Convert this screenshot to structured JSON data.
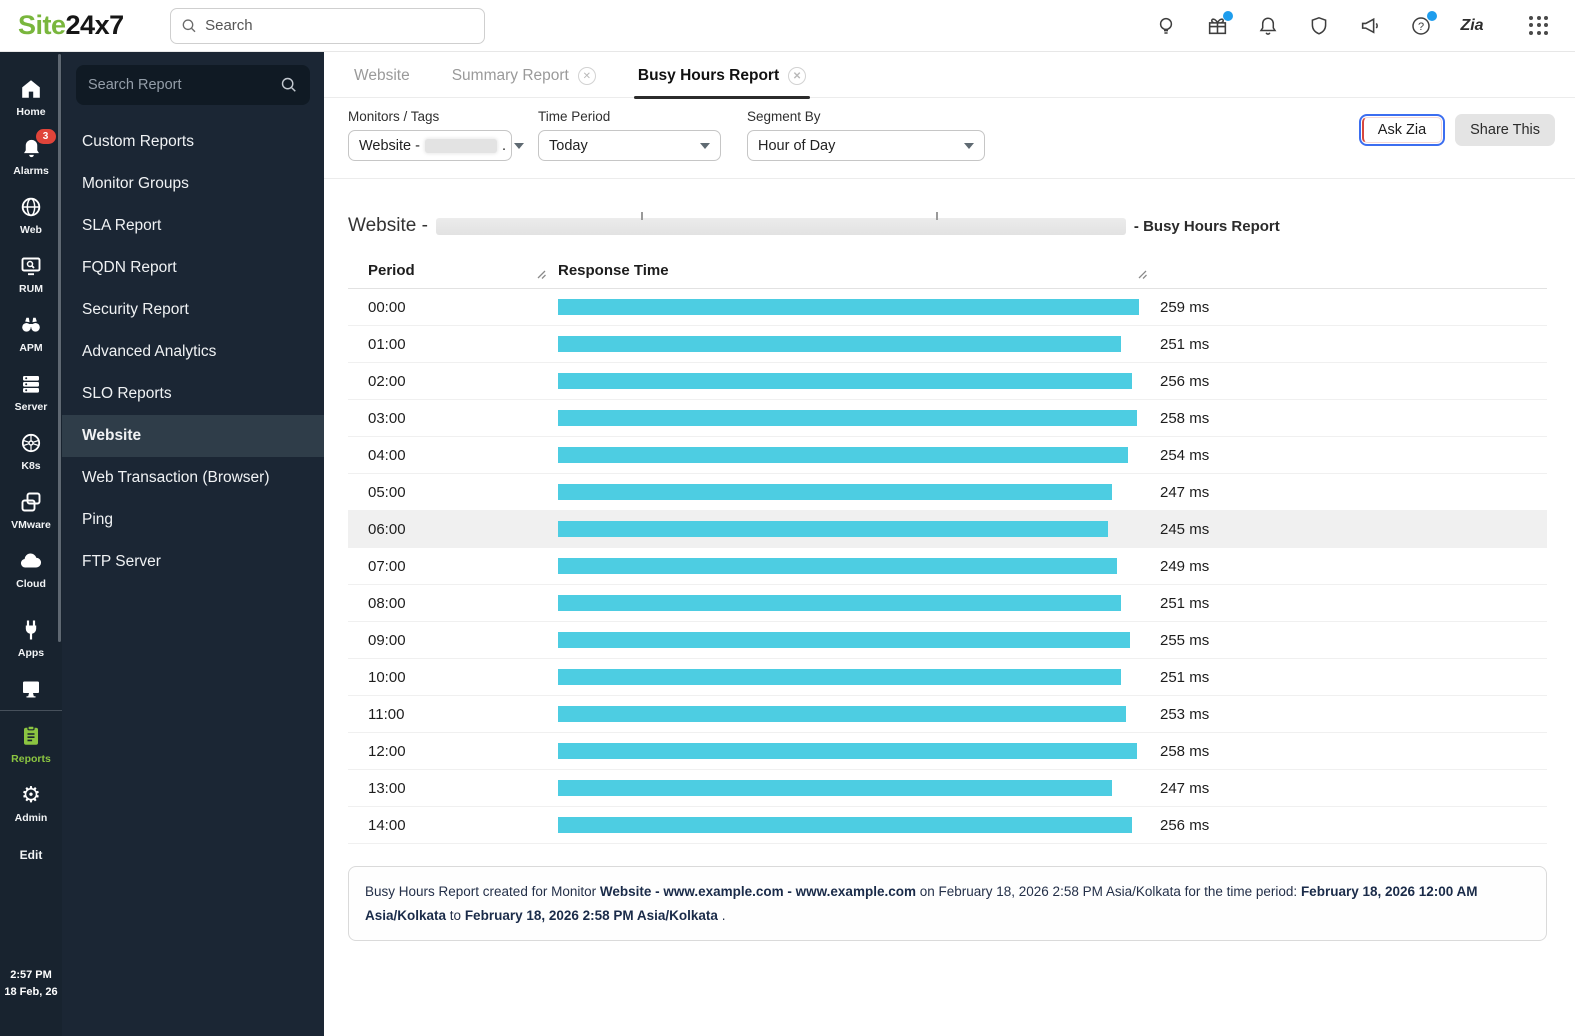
{
  "topbar": {
    "logo_green": "Site",
    "logo_dark": "24x7",
    "search_placeholder": "Search",
    "icons": [
      "bulb-icon",
      "gift-icon (notification-dot)",
      "bell-icon",
      "shield-icon",
      "megaphone-icon",
      "help-icon (notification-dot)",
      "zia-icon",
      "apps-grid-icon"
    ],
    "accent_dot_color": "#1e9ded"
  },
  "rail": {
    "background": "#18232f",
    "items": [
      {
        "label": "Home",
        "icon": "home-icon"
      },
      {
        "label": "Alarms",
        "icon": "alarm-bell-icon",
        "badge": "3"
      },
      {
        "label": "Web",
        "icon": "globe-icon"
      },
      {
        "label": "RUM",
        "icon": "monitor-search-icon"
      },
      {
        "label": "APM",
        "icon": "binoculars-icon"
      },
      {
        "label": "Server",
        "icon": "server-stack-icon"
      },
      {
        "label": "K8s",
        "icon": "kubernetes-icon"
      },
      {
        "label": "VMware",
        "icon": "vmware-boxes-icon"
      },
      {
        "label": "Cloud",
        "icon": "cloud-icon"
      },
      {
        "label": "Apps",
        "icon": "plug-icon"
      },
      {
        "label": "",
        "icon": "desktop-icon"
      },
      {
        "label": "Reports",
        "icon": "clipboard-icon",
        "active": true,
        "active_color": "#8bc541"
      },
      {
        "label": "Admin",
        "icon": "gear-icon"
      },
      {
        "label": "Edit",
        "icon": ""
      }
    ],
    "badge_color": "#e0443a",
    "clock": "2:57 PM",
    "date": "18 Feb, 26"
  },
  "reports_nav": {
    "search_placeholder": "Search Report",
    "items": [
      {
        "label": "Custom Reports"
      },
      {
        "label": "Monitor Groups"
      },
      {
        "label": "SLA Report"
      },
      {
        "label": "FQDN Report"
      },
      {
        "label": "Security Report"
      },
      {
        "label": "Advanced Analytics"
      },
      {
        "label": "SLO Reports"
      },
      {
        "label": "Website",
        "active": true
      },
      {
        "label": "Web Transaction (Browser)"
      },
      {
        "label": "Ping"
      },
      {
        "label": "FTP Server"
      }
    ]
  },
  "tabs": [
    {
      "label": "Website",
      "closable": false,
      "active": false
    },
    {
      "label": "Summary Report",
      "closable": true,
      "active": false
    },
    {
      "label": "Busy Hours Report",
      "closable": true,
      "active": true
    }
  ],
  "filters": {
    "monitors": {
      "label": "Monitors / Tags",
      "value_prefix": "Website -",
      "value_suffix": "."
    },
    "time_period": {
      "label": "Time Period",
      "value": "Today"
    },
    "segment_by": {
      "label": "Segment By",
      "value": "Hour of Day"
    }
  },
  "actions": {
    "ask_zia": "Ask Zia",
    "share_this": "Share This"
  },
  "report": {
    "title_prefix": "Website -",
    "title_suffix": "- Busy Hours Report",
    "highlighted_row_index": 6
  },
  "chart_data": {
    "type": "bar",
    "title": "Website - Busy Hours Report",
    "columns": [
      "Period",
      "Response Time"
    ],
    "categories": [
      "00:00",
      "01:00",
      "02:00",
      "03:00",
      "04:00",
      "05:00",
      "06:00",
      "07:00",
      "08:00",
      "09:00",
      "10:00",
      "11:00",
      "12:00",
      "13:00",
      "14:00"
    ],
    "values": [
      259,
      251,
      256,
      258,
      254,
      247,
      245,
      249,
      251,
      255,
      251,
      253,
      258,
      247,
      256
    ],
    "unit": "ms",
    "bar_color": "#4dcde2",
    "xlim": [
      0,
      259
    ],
    "orientation": "horizontal",
    "grid": false,
    "legend": false
  },
  "footnote": {
    "s1": "Busy Hours Report created for Monitor ",
    "s2": "Website - www.example.com - www.example.com",
    "s3": " on February 18, 2026 2:58 PM Asia/Kolkata for the time period: ",
    "s4": "February 18, 2026 12:00 AM Asia/Kolkata",
    "s5": " to ",
    "s6": "February 18, 2026 2:58 PM Asia/Kolkata",
    "s7": " ."
  }
}
